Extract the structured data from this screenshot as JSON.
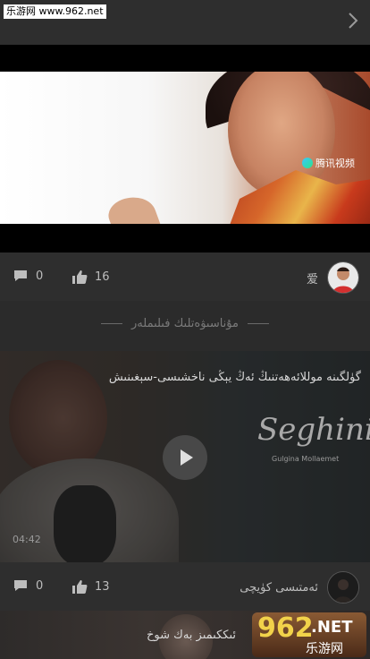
{
  "header": {
    "watermark": "乐游网 www.962.net",
    "next_icon": "chevron-right-icon"
  },
  "video1": {
    "logo_text": "腾讯视频"
  },
  "post1": {
    "comments": "0",
    "likes": "16",
    "author": "爱"
  },
  "section": {
    "title": "مۇناسىۋەتلىك فىلىملەر"
  },
  "video2": {
    "title": "گۈلگىنە موللائەھەتنىڭ ئەڭ يېڭى ناخشىسى-سېغىنىش",
    "brand": "Seghinis",
    "brand_sub": "Gulgina Mollaemet",
    "duration": "04:42"
  },
  "post2": {
    "comments": "0",
    "likes": "13",
    "author": "ئەمتىسى كۈيچى"
  },
  "video3": {
    "title": "ئىككىمىز بەك شوخ"
  },
  "badge": {
    "number": "962",
    "net": ".NET",
    "site": "乐游网"
  },
  "colors": {
    "background": "#2b2b2b",
    "text": "#bdbdbd"
  }
}
